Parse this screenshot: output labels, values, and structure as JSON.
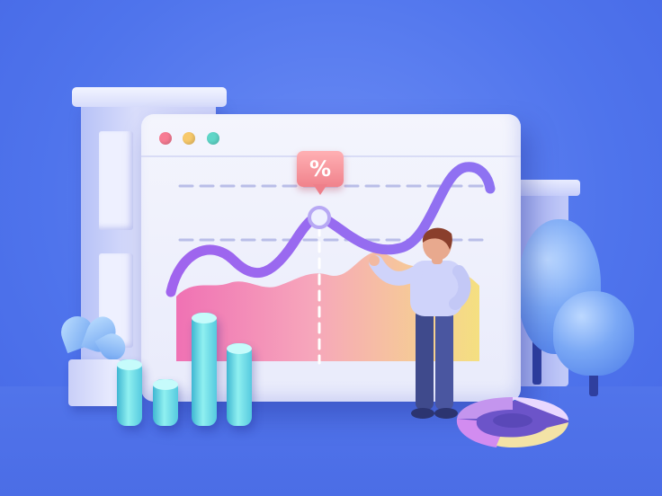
{
  "colors": {
    "background": "#4f74ec",
    "window": "#f1f2fc",
    "dot_red": "#f77b93",
    "dot_yellow": "#f7c96b",
    "dot_green": "#5fd6c8",
    "line": "#9b6cf0",
    "badge": "#f0828c",
    "bars": "#5ccfe0"
  },
  "window": {
    "badge_symbol": "%"
  },
  "icons": {
    "percent": "percent-icon",
    "person": "person-figure",
    "plant": "plant-icon",
    "donut": "donut-chart-icon",
    "tree": "tree-icon",
    "building": "building-icon"
  }
}
